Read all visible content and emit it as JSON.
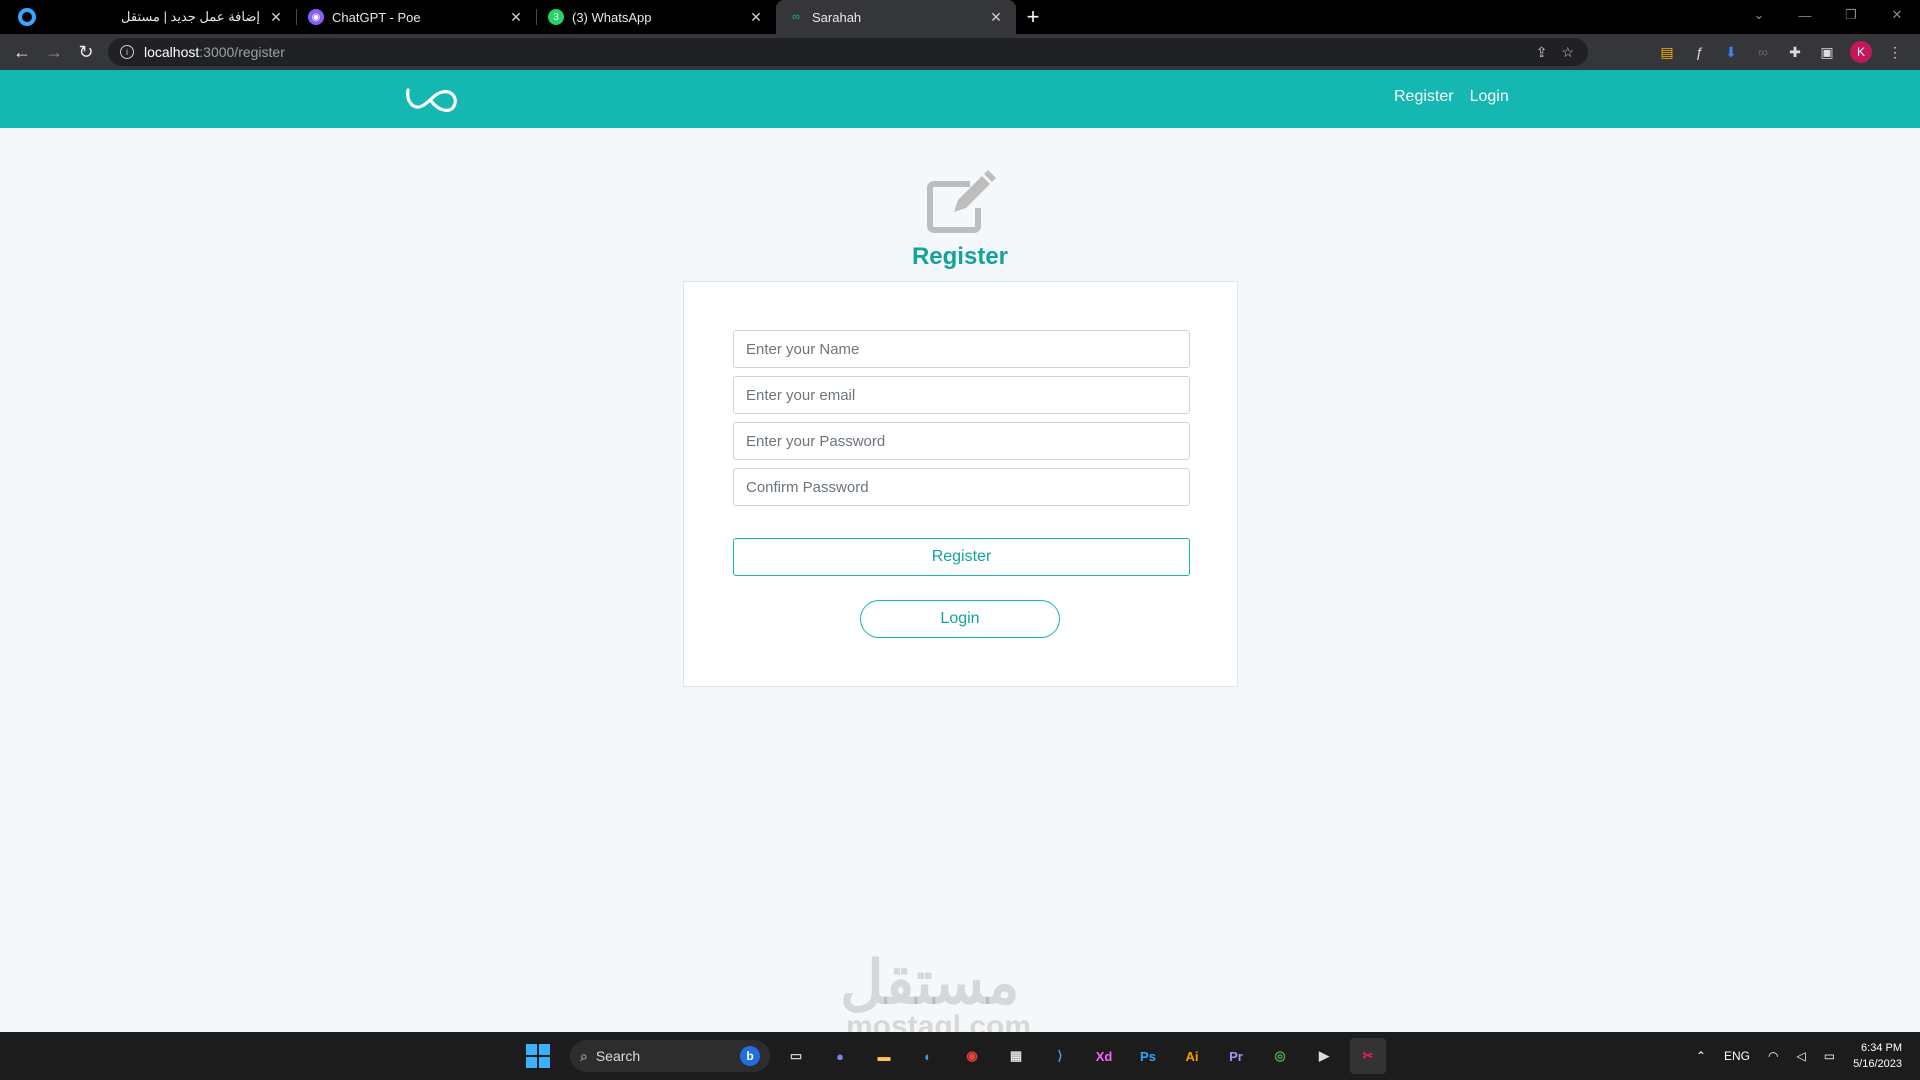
{
  "browser": {
    "tabs": [
      {
        "title": "إضافة عمل جديد | مستقل",
        "favicon": "mostaql-icon"
      },
      {
        "title": "ChatGPT - Poe",
        "favicon": "poe-icon"
      },
      {
        "title": "(3) WhatsApp",
        "favicon": "whatsapp-icon"
      },
      {
        "title": "Sarahah",
        "favicon": "sarahah-icon"
      }
    ],
    "active_tab": 3,
    "url_host": "localhost",
    "url_path": ":3000/register",
    "profile_initial": "K"
  },
  "navbar": {
    "brand_icon": "infinity-logo",
    "links": {
      "register": "Register",
      "login": "Login"
    }
  },
  "register": {
    "heading": "Register",
    "icon": "edit-icon",
    "fields": {
      "name_placeholder": "Enter your Name",
      "email_placeholder": "Enter your email",
      "password_placeholder": "Enter your Password",
      "confirm_placeholder": "Confirm Password"
    },
    "submit_label": "Register",
    "login_label": "Login"
  },
  "watermark": {
    "text": "مستقل",
    "sub": "mostaql.com"
  },
  "taskbar": {
    "search_label": "Search",
    "apps": [
      "Xd",
      "Ps",
      "Ai",
      "Pr"
    ],
    "language": "ENG",
    "time": "6:34 PM",
    "date": "5/16/2023"
  },
  "colors": {
    "primary": "#14b8b0",
    "primary_text": "#14a39c",
    "page_bg": "#f5f8fa"
  }
}
